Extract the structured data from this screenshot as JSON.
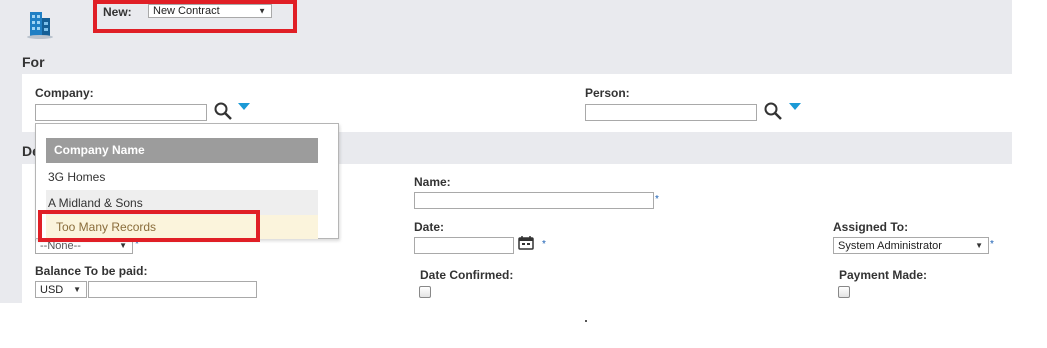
{
  "header": {
    "new_label": "New:",
    "new_select_value": "New Contract",
    "logo_icon": "building-icon"
  },
  "for_section": {
    "title": "For",
    "company_label": "Company:",
    "company_value": "",
    "person_label": "Person:",
    "person_value": ""
  },
  "details_section": {
    "title_partial": "De"
  },
  "company_dropdown": {
    "header": "Company Name",
    "items": [
      "3G Homes",
      "A Midland & Sons",
      "Too Many Records"
    ]
  },
  "form": {
    "status_select_value": "--None--",
    "balance_label": "Balance To be paid:",
    "currency_value": "USD",
    "balance_value": "",
    "name_label": "Name:",
    "name_value": "",
    "date_label": "Date:",
    "date_value": "",
    "date_confirmed_label": "Date Confirmed:",
    "assigned_to_label": "Assigned To:",
    "assigned_to_value": "System Administrator",
    "payment_made_label": "Payment Made:",
    "required_marker": "*"
  },
  "colors": {
    "highlight_red": "#e01f26",
    "accent_blue": "#1b9ad6",
    "panel_bg": "#e9eaee"
  }
}
